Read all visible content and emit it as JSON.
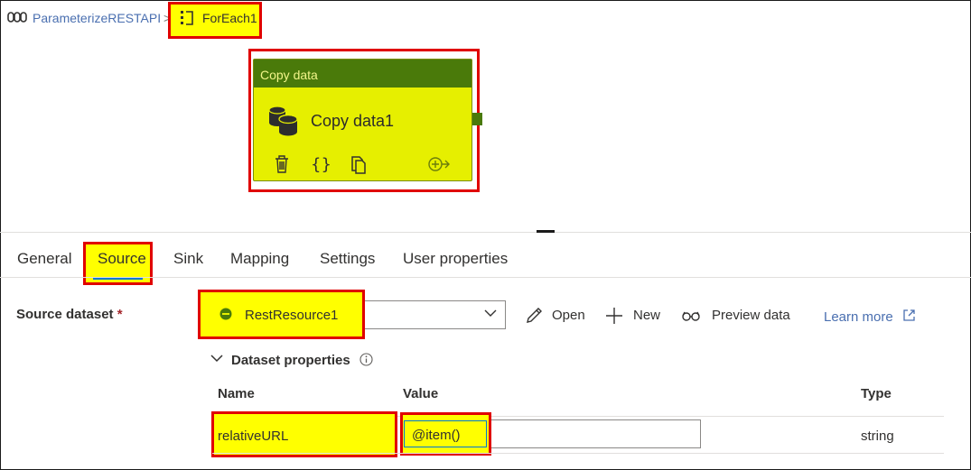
{
  "breadcrumb": {
    "pipeline": "ParameterizeRESTAPI",
    "separator": ">",
    "activity": "ForEach1"
  },
  "node": {
    "type_label": "Copy data",
    "name": "Copy data1",
    "actions": [
      "delete-icon",
      "code-braces-icon",
      "copy-icon",
      "add-output-icon"
    ]
  },
  "tabs": [
    "General",
    "Source",
    "Sink",
    "Mapping",
    "Settings",
    "User properties"
  ],
  "active_tab": "Source",
  "source": {
    "label": "Source dataset",
    "required_marker": "*",
    "dataset": "RestResource1",
    "actions": {
      "open": "Open",
      "new": "New",
      "preview": "Preview data",
      "learn_more": "Learn more"
    }
  },
  "dataset_properties": {
    "title": "Dataset properties",
    "columns": [
      "Name",
      "Value",
      "Type"
    ],
    "rows": [
      {
        "name": "relativeURL",
        "value": "@item()",
        "type": "string"
      }
    ]
  },
  "colors": {
    "highlight": "#ffff00",
    "callout_border": "#e00000",
    "node_header": "#4a7a0a",
    "node_body": "#e6ef00",
    "link": "#4a6fb0",
    "accent": "#0078d4"
  }
}
